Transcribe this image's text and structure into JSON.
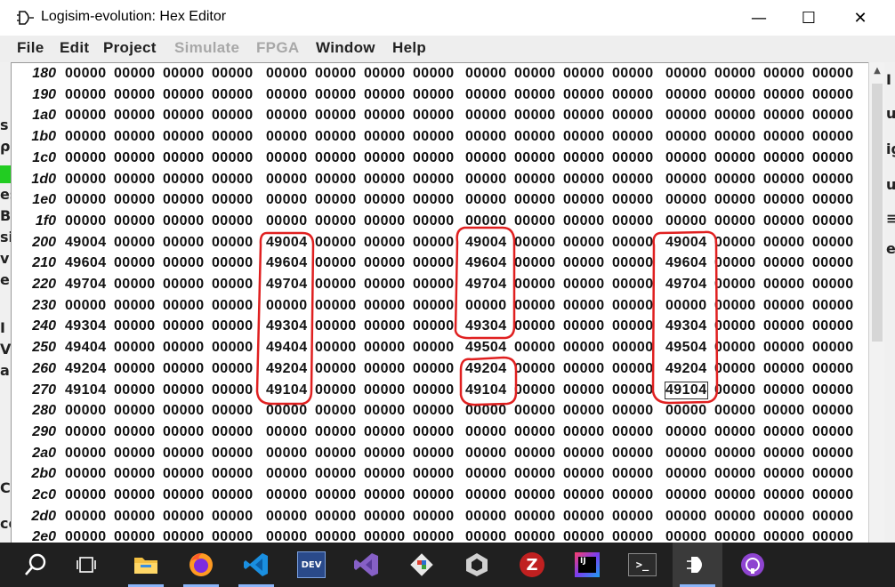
{
  "window": {
    "title": "Logisim-evolution: Hex Editor",
    "minimize_glyph": "—",
    "maximize_glyph": "☐",
    "close_glyph": "✕"
  },
  "menu": [
    {
      "label": "File",
      "enabled": true
    },
    {
      "label": "Edit",
      "enabled": true
    },
    {
      "label": "Project",
      "enabled": true
    },
    {
      "label": "Simulate",
      "enabled": false
    },
    {
      "label": "FPGA",
      "enabled": false
    },
    {
      "label": "Window",
      "enabled": true
    },
    {
      "label": "Help",
      "enabled": true
    }
  ],
  "hex_rows": [
    {
      "addr": "180",
      "cells": [
        "00000",
        "00000",
        "00000",
        "00000",
        "00000",
        "00000",
        "00000",
        "00000",
        "00000",
        "00000",
        "00000",
        "00000",
        "00000",
        "00000",
        "00000",
        "00000"
      ]
    },
    {
      "addr": "190",
      "cells": [
        "00000",
        "00000",
        "00000",
        "00000",
        "00000",
        "00000",
        "00000",
        "00000",
        "00000",
        "00000",
        "00000",
        "00000",
        "00000",
        "00000",
        "00000",
        "00000"
      ]
    },
    {
      "addr": "1a0",
      "cells": [
        "00000",
        "00000",
        "00000",
        "00000",
        "00000",
        "00000",
        "00000",
        "00000",
        "00000",
        "00000",
        "00000",
        "00000",
        "00000",
        "00000",
        "00000",
        "00000"
      ]
    },
    {
      "addr": "1b0",
      "cells": [
        "00000",
        "00000",
        "00000",
        "00000",
        "00000",
        "00000",
        "00000",
        "00000",
        "00000",
        "00000",
        "00000",
        "00000",
        "00000",
        "00000",
        "00000",
        "00000"
      ]
    },
    {
      "addr": "1c0",
      "cells": [
        "00000",
        "00000",
        "00000",
        "00000",
        "00000",
        "00000",
        "00000",
        "00000",
        "00000",
        "00000",
        "00000",
        "00000",
        "00000",
        "00000",
        "00000",
        "00000"
      ]
    },
    {
      "addr": "1d0",
      "cells": [
        "00000",
        "00000",
        "00000",
        "00000",
        "00000",
        "00000",
        "00000",
        "00000",
        "00000",
        "00000",
        "00000",
        "00000",
        "00000",
        "00000",
        "00000",
        "00000"
      ]
    },
    {
      "addr": "1e0",
      "cells": [
        "00000",
        "00000",
        "00000",
        "00000",
        "00000",
        "00000",
        "00000",
        "00000",
        "00000",
        "00000",
        "00000",
        "00000",
        "00000",
        "00000",
        "00000",
        "00000"
      ]
    },
    {
      "addr": "1f0",
      "cells": [
        "00000",
        "00000",
        "00000",
        "00000",
        "00000",
        "00000",
        "00000",
        "00000",
        "00000",
        "00000",
        "00000",
        "00000",
        "00000",
        "00000",
        "00000",
        "00000"
      ]
    },
    {
      "addr": "200",
      "cells": [
        "49004",
        "00000",
        "00000",
        "00000",
        "49004",
        "00000",
        "00000",
        "00000",
        "49004",
        "00000",
        "00000",
        "00000",
        "49004",
        "00000",
        "00000",
        "00000"
      ]
    },
    {
      "addr": "210",
      "cells": [
        "49604",
        "00000",
        "00000",
        "00000",
        "49604",
        "00000",
        "00000",
        "00000",
        "49604",
        "00000",
        "00000",
        "00000",
        "49604",
        "00000",
        "00000",
        "00000"
      ]
    },
    {
      "addr": "220",
      "cells": [
        "49704",
        "00000",
        "00000",
        "00000",
        "49704",
        "00000",
        "00000",
        "00000",
        "49704",
        "00000",
        "00000",
        "00000",
        "49704",
        "00000",
        "00000",
        "00000"
      ]
    },
    {
      "addr": "230",
      "cells": [
        "00000",
        "00000",
        "00000",
        "00000",
        "00000",
        "00000",
        "00000",
        "00000",
        "00000",
        "00000",
        "00000",
        "00000",
        "00000",
        "00000",
        "00000",
        "00000"
      ]
    },
    {
      "addr": "240",
      "cells": [
        "49304",
        "00000",
        "00000",
        "00000",
        "49304",
        "00000",
        "00000",
        "00000",
        "49304",
        "00000",
        "00000",
        "00000",
        "49304",
        "00000",
        "00000",
        "00000"
      ]
    },
    {
      "addr": "250",
      "cells": [
        "49404",
        "00000",
        "00000",
        "00000",
        "49404",
        "00000",
        "00000",
        "00000",
        "49504",
        "00000",
        "00000",
        "00000",
        "49504",
        "00000",
        "00000",
        "00000"
      ]
    },
    {
      "addr": "260",
      "cells": [
        "49204",
        "00000",
        "00000",
        "00000",
        "49204",
        "00000",
        "00000",
        "00000",
        "49204",
        "00000",
        "00000",
        "00000",
        "49204",
        "00000",
        "00000",
        "00000"
      ]
    },
    {
      "addr": "270",
      "cells": [
        "49104",
        "00000",
        "00000",
        "00000",
        "49104",
        "00000",
        "00000",
        "00000",
        "49104",
        "00000",
        "00000",
        "00000",
        "49104",
        "00000",
        "00000",
        "00000"
      ]
    },
    {
      "addr": "280",
      "cells": [
        "00000",
        "00000",
        "00000",
        "00000",
        "00000",
        "00000",
        "00000",
        "00000",
        "00000",
        "00000",
        "00000",
        "00000",
        "00000",
        "00000",
        "00000",
        "00000"
      ]
    },
    {
      "addr": "290",
      "cells": [
        "00000",
        "00000",
        "00000",
        "00000",
        "00000",
        "00000",
        "00000",
        "00000",
        "00000",
        "00000",
        "00000",
        "00000",
        "00000",
        "00000",
        "00000",
        "00000"
      ]
    },
    {
      "addr": "2a0",
      "cells": [
        "00000",
        "00000",
        "00000",
        "00000",
        "00000",
        "00000",
        "00000",
        "00000",
        "00000",
        "00000",
        "00000",
        "00000",
        "00000",
        "00000",
        "00000",
        "00000"
      ]
    },
    {
      "addr": "2b0",
      "cells": [
        "00000",
        "00000",
        "00000",
        "00000",
        "00000",
        "00000",
        "00000",
        "00000",
        "00000",
        "00000",
        "00000",
        "00000",
        "00000",
        "00000",
        "00000",
        "00000"
      ]
    },
    {
      "addr": "2c0",
      "cells": [
        "00000",
        "00000",
        "00000",
        "00000",
        "00000",
        "00000",
        "00000",
        "00000",
        "00000",
        "00000",
        "00000",
        "00000",
        "00000",
        "00000",
        "00000",
        "00000"
      ]
    },
    {
      "addr": "2d0",
      "cells": [
        "00000",
        "00000",
        "00000",
        "00000",
        "00000",
        "00000",
        "00000",
        "00000",
        "00000",
        "00000",
        "00000",
        "00000",
        "00000",
        "00000",
        "00000",
        "00000"
      ]
    },
    {
      "addr": "2e0",
      "cells": [
        "00000",
        "00000",
        "00000",
        "00000",
        "00000",
        "00000",
        "00000",
        "00000",
        "00000",
        "00000",
        "00000",
        "00000",
        "00000",
        "00000",
        "00000",
        "00000"
      ]
    }
  ],
  "selected_cell": {
    "addr": "270",
    "column": 12,
    "value": "49104"
  },
  "left_strip_fragments": [
    "s",
    "ρe",
    "es",
    "B",
    "si",
    "v",
    "er",
    "I",
    "V",
    "a",
    "C",
    "co"
  ],
  "right_strip_fragments": [
    "Ι",
    "u",
    "ig",
    "u",
    "≡",
    "e"
  ],
  "annotation_color": "#e02020",
  "taskbar": [
    {
      "icon": "search-icon",
      "label": "Search"
    },
    {
      "icon": "task-view-icon",
      "label": "Task View"
    },
    {
      "icon": "file-explorer-icon",
      "label": "File Explorer",
      "running": true
    },
    {
      "icon": "firefox-icon",
      "label": "Firefox",
      "running": true
    },
    {
      "icon": "vscode-icon",
      "label": "Visual Studio Code",
      "running": true
    },
    {
      "icon": "dev-cpp-icon",
      "label": "Dev-C++",
      "glyph": "DEV"
    },
    {
      "icon": "visual-studio-icon",
      "label": "Visual Studio"
    },
    {
      "icon": "git-icon",
      "label": "Git"
    },
    {
      "icon": "unity-icon",
      "label": "Unity"
    },
    {
      "icon": "z-icon",
      "label": "Z",
      "glyph": "Z"
    },
    {
      "icon": "intellij-icon",
      "label": "IntelliJ IDEA",
      "glyph": "IJ"
    },
    {
      "icon": "terminal-icon",
      "label": "Terminal",
      "glyph": ">_"
    },
    {
      "icon": "logisim-icon",
      "label": "Logisim-evolution",
      "running": true,
      "active": true
    },
    {
      "icon": "github-icon",
      "label": "GitHub Desktop"
    }
  ]
}
